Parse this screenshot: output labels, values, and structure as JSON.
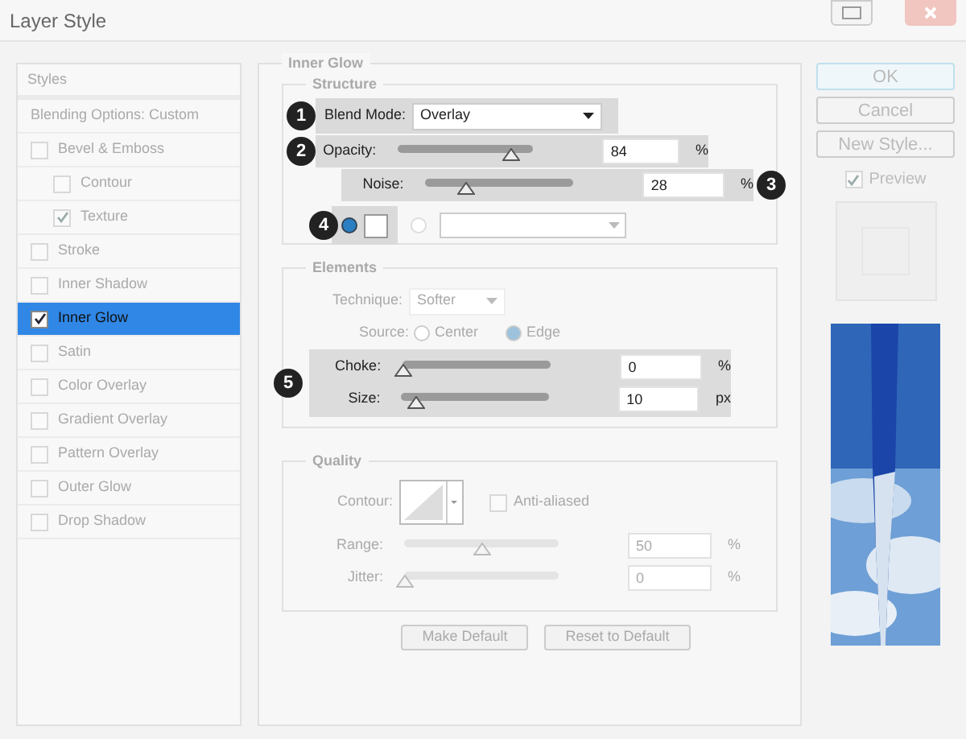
{
  "window": {
    "title": "Layer Style"
  },
  "styles_panel": {
    "header": "Styles",
    "items": [
      {
        "kind": "blend",
        "label": "Blending Options: Custom",
        "selected": false
      },
      {
        "kind": "option",
        "label": "Bevel & Emboss",
        "checked": false,
        "selected": false,
        "children": [
          {
            "kind": "option",
            "label": "Contour",
            "checked": false,
            "selected": false
          },
          {
            "kind": "option",
            "label": "Texture",
            "checked": true,
            "selected": false
          }
        ]
      },
      {
        "kind": "option",
        "label": "Stroke",
        "checked": false,
        "selected": false
      },
      {
        "kind": "option",
        "label": "Inner Shadow",
        "checked": false,
        "selected": false
      },
      {
        "kind": "option",
        "label": "Inner Glow",
        "checked": true,
        "selected": true
      },
      {
        "kind": "option",
        "label": "Satin",
        "checked": false,
        "selected": false
      },
      {
        "kind": "option",
        "label": "Color Overlay",
        "checked": false,
        "selected": false
      },
      {
        "kind": "option",
        "label": "Gradient Overlay",
        "checked": false,
        "selected": false
      },
      {
        "kind": "option",
        "label": "Pattern Overlay",
        "checked": false,
        "selected": false
      },
      {
        "kind": "option",
        "label": "Outer Glow",
        "checked": false,
        "selected": false
      },
      {
        "kind": "option",
        "label": "Drop Shadow",
        "checked": false,
        "selected": false
      }
    ]
  },
  "inner_glow": {
    "title": "Inner Glow",
    "structure": {
      "title": "Structure",
      "disabled": false,
      "blend_mode": {
        "label": "Blend Mode:",
        "value": "Overlay",
        "callout": "1"
      },
      "opacity": {
        "label": "Opacity:",
        "level": 0.84,
        "value": "84",
        "unit": "%",
        "callout": "2"
      },
      "noise": {
        "label": "Noise:",
        "level": 0.28,
        "value": "28",
        "unit": "%",
        "callout": "3"
      },
      "fill": {
        "callout": "4",
        "options": [
          {
            "kind": "color",
            "selected": true
          },
          {
            "kind": "gradient",
            "selected": false
          }
        ]
      }
    },
    "elements": {
      "title": "Elements",
      "disabled": true,
      "technique": {
        "label": "Technique:",
        "value": "Softer"
      },
      "source": {
        "label": "Source:",
        "options": [
          {
            "label": "Center",
            "selected": false
          },
          {
            "label": "Edge",
            "selected": true
          }
        ]
      },
      "callout": "5",
      "choke": {
        "label": "Choke:",
        "level": 0.0,
        "value": "0",
        "unit": "%"
      },
      "size": {
        "label": "Size:",
        "level": 0.1,
        "value": "10",
        "unit": "px"
      }
    },
    "quality": {
      "title": "Quality",
      "disabled": true,
      "contour_label": "Contour:",
      "anti_aliased": {
        "label": "Anti-aliased",
        "checked": false
      },
      "range": {
        "label": "Range:",
        "level": 0.5,
        "value": "50",
        "unit": "%"
      },
      "jitter": {
        "label": "Jitter:",
        "level": 0.0,
        "value": "0",
        "unit": "%"
      }
    },
    "buttons": [
      "Make Default",
      "Reset to Default"
    ]
  },
  "actions": {
    "buttons": [
      {
        "label": "OK",
        "selected": true
      },
      {
        "label": "Cancel",
        "selected": false
      },
      {
        "label": "New Style...",
        "selected": false
      }
    ],
    "preview": {
      "label": "Preview",
      "checked": true
    }
  }
}
